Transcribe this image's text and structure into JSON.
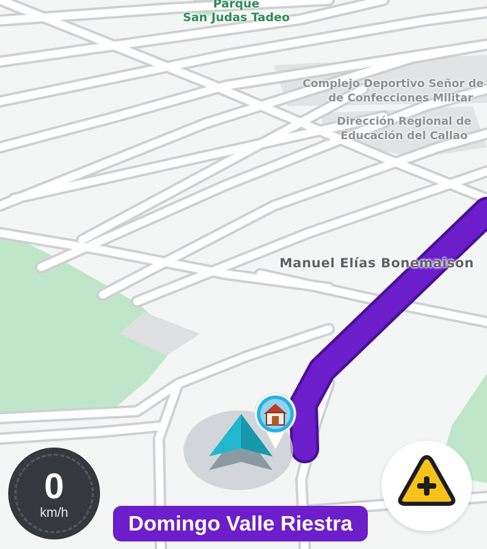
{
  "map": {
    "park_label_line1": "Parque",
    "park_label_line2": "San Judas Tadeo",
    "poi_complejo_line1": "Complejo Deportivo Señor de lo",
    "poi_complejo_line2": "de Confecciones Militar",
    "poi_direccion_line1": "Dirección Regional de",
    "poi_direccion_line2": "Educación del Callao",
    "street_label": "Manuel Elías Bonemaison",
    "route_color": "#6b1ec9",
    "park_color": "#bfe6c8",
    "vehicle_color": "#22b7cc",
    "home_marker_icon": "home-icon"
  },
  "speedometer": {
    "value": "0",
    "unit": "km/h"
  },
  "current_street": "Domingo Valle Riestra",
  "report_button": {
    "icon": "alert-plus-icon",
    "color": "#f7c21a"
  }
}
